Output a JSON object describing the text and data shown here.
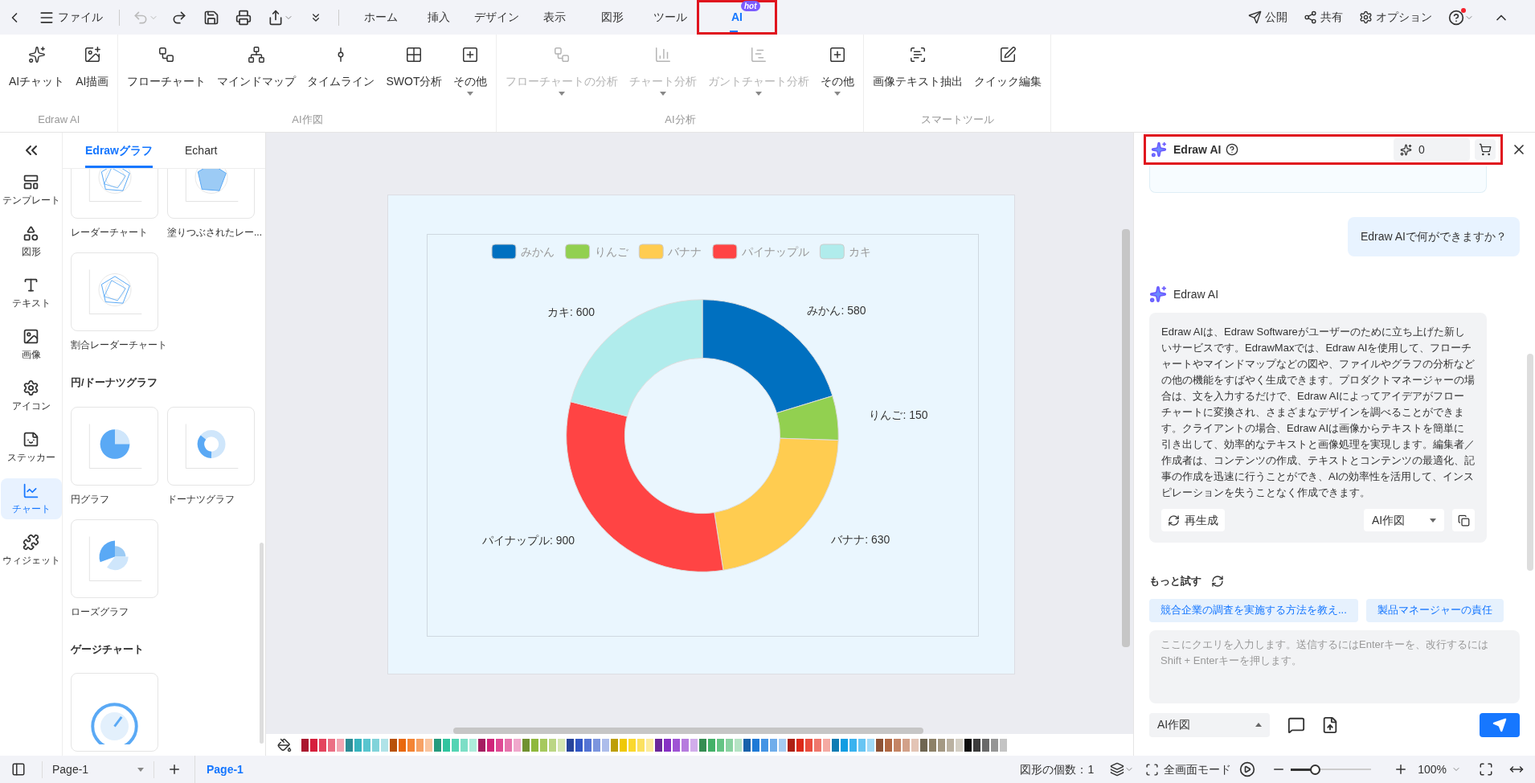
{
  "top_bar": {
    "file_menu": "ファイル",
    "undo_disabled": true,
    "tabs": [
      {
        "label": "ホーム",
        "selected": false,
        "highlighted": false
      },
      {
        "label": "挿入",
        "selected": false,
        "highlighted": false
      },
      {
        "label": "デザイン",
        "selected": false,
        "highlighted": false
      },
      {
        "label": "表示",
        "selected": false,
        "highlighted": false
      },
      {
        "label": "図形",
        "selected": false,
        "highlighted": false
      },
      {
        "label": "ツール",
        "selected": false,
        "highlighted": false
      },
      {
        "label": "AI",
        "selected": true,
        "highlighted": true,
        "badge": "hot"
      }
    ],
    "actions": [
      "公開",
      "共有",
      "オプション"
    ],
    "help_notification": true
  },
  "ribbon": {
    "groups": [
      {
        "label": "Edraw AI",
        "items": [
          {
            "label": "AIチャット",
            "disabled": false,
            "dropdown": false
          },
          {
            "label": "AI描画",
            "disabled": false,
            "dropdown": false
          }
        ]
      },
      {
        "label": "AI作図",
        "items": [
          {
            "label": "フローチャート",
            "disabled": false,
            "dropdown": false
          },
          {
            "label": "マインドマップ",
            "disabled": false,
            "dropdown": false
          },
          {
            "label": "タイムライン",
            "disabled": false,
            "dropdown": false
          },
          {
            "label": "SWOT分析",
            "disabled": false,
            "dropdown": false
          },
          {
            "label": "その他",
            "disabled": false,
            "dropdown": true
          }
        ]
      },
      {
        "label": "AI分析",
        "items": [
          {
            "label": "フローチャートの分析",
            "disabled": true,
            "dropdown": true
          },
          {
            "label": "チャート分析",
            "disabled": true,
            "dropdown": true
          },
          {
            "label": "ガントチャート分析",
            "disabled": true,
            "dropdown": true
          },
          {
            "label": "その他",
            "disabled": false,
            "dropdown": true
          }
        ]
      },
      {
        "label": "スマートツール",
        "items": [
          {
            "label": "画像テキスト抽出",
            "disabled": false,
            "dropdown": false
          },
          {
            "label": "クイック編集",
            "disabled": false,
            "dropdown": false
          }
        ]
      }
    ]
  },
  "sidebar": {
    "items": [
      {
        "label": "テンプレート",
        "selected": false
      },
      {
        "label": "図形",
        "selected": false
      },
      {
        "label": "テキスト",
        "selected": false
      },
      {
        "label": "画像",
        "selected": false
      },
      {
        "label": "アイコン",
        "selected": false
      },
      {
        "label": "ステッカー",
        "selected": false
      },
      {
        "label": "チャート",
        "selected": true
      },
      {
        "label": "ウィジェット",
        "selected": false
      }
    ]
  },
  "library": {
    "tabs": [
      {
        "label": "Edrawグラフ",
        "selected": true
      },
      {
        "label": "Echart",
        "selected": false
      }
    ],
    "sections": [
      {
        "items": [
          {
            "label": "レーダーチャート",
            "kind": "radar"
          },
          {
            "label": "塗りつぶされたレー...",
            "kind": "radar-filled"
          },
          {
            "label": "割合レーダーチャート",
            "kind": "radar-percent"
          }
        ]
      },
      {
        "title": "円/ドーナツグラフ",
        "items": [
          {
            "label": "円グラフ",
            "kind": "pie"
          },
          {
            "label": "ドーナツグラフ",
            "kind": "donut"
          },
          {
            "label": "ローズグラフ",
            "kind": "rose"
          }
        ]
      },
      {
        "title": "ゲージチャート",
        "items": [
          {
            "kind": "gauge"
          }
        ]
      }
    ]
  },
  "canvas": {
    "chart_data": {
      "type": "donut",
      "categories": [
        "みかん",
        "りんご",
        "バナナ",
        "パイナップル",
        "カキ"
      ],
      "values": [
        580,
        150,
        630,
        900,
        600
      ],
      "legend": "top",
      "colors": [
        "#0070c0",
        "#92d050",
        "#ffcc50",
        "#ff4444",
        "#b0ecec"
      ],
      "value_labels": [
        "みかん: 580",
        "りんご: 150",
        "バナナ: 630",
        "パイナップル: 900",
        "カキ: 600"
      ]
    }
  },
  "ai_panel": {
    "title": "Edraw AI",
    "highlighted": true,
    "credits": "0",
    "user_message": "Edraw AIで何ができますか？",
    "assistant_name": "Edraw AI",
    "answer": "Edraw AIは、Edraw Softwareがユーザーのために立ち上げた新しいサービスです。EdrawMaxでは、Edraw AIを使用して、フローチャートやマインドマップなどの図や、ファイルやグラフの分析などの他の機能をすばやく生成できます。プロダクトマネージャーの場合は、文を入力するだけで、Edraw AIによってアイデアがフローチャートに変換され、さまざまなデザインを調べることができます。クライアントの場合、Edraw AIは画像からテキストを簡単に引き出して、効率的なテキストと画像処理を実現します。編集者／作成者は、コンテンツの作成、テキストとコンテンツの最適化、記事の作成を迅速に行うことができ、AIの効率性を活用して、インスピレーションを失うことなく作成できます。",
    "regenerate": "再生成",
    "mode_select": "AI作図",
    "more_title": "もっと試す",
    "suggestions": [
      "競合企業の調査を実施する方法を教え...",
      "製品マネージャーの責任"
    ],
    "input": {
      "placeholder": "ここにクエリを入力します。送信するにはEnterキーを、改行するにはShift + Enterキーを押します。"
    },
    "input_mode": "AI作図"
  },
  "status_bar": {
    "page_select": "Page-1",
    "pages": [
      {
        "label": "Page-1",
        "selected": true
      }
    ],
    "shape_count": "図形の個数：1",
    "fullscreen": "全画面モード",
    "zoom": {
      "level": 0.3
    },
    "zoom_value": "100%"
  }
}
